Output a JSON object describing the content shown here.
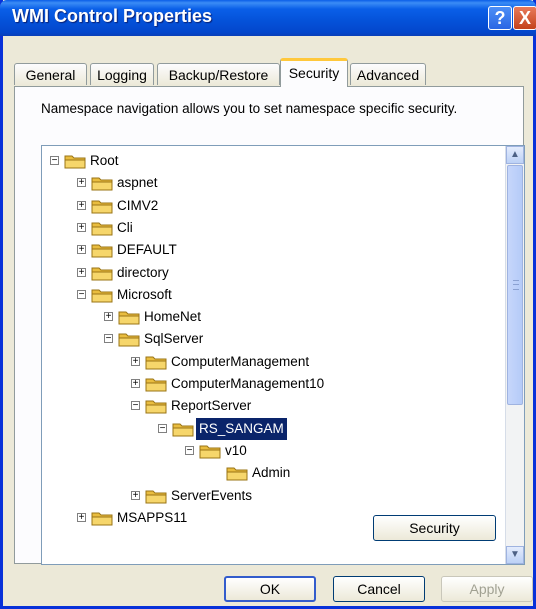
{
  "window": {
    "title": "WMI Control Properties",
    "help_glyph": "?",
    "close_glyph": "X"
  },
  "tabs": [
    "General",
    "Logging",
    "Backup/Restore",
    "Security",
    "Advanced"
  ],
  "active_tab": "Security",
  "description": "Namespace navigation allows you to set namespace specific security.",
  "tree": [
    {
      "label": "Root",
      "level": 0,
      "expander": "minus"
    },
    {
      "label": "aspnet",
      "level": 1,
      "expander": "plus"
    },
    {
      "label": "CIMV2",
      "level": 1,
      "expander": "plus"
    },
    {
      "label": "Cli",
      "level": 1,
      "expander": "plus"
    },
    {
      "label": "DEFAULT",
      "level": 1,
      "expander": "plus"
    },
    {
      "label": "directory",
      "level": 1,
      "expander": "plus"
    },
    {
      "label": "Microsoft",
      "level": 1,
      "expander": "minus"
    },
    {
      "label": "HomeNet",
      "level": 2,
      "expander": "plus"
    },
    {
      "label": "SqlServer",
      "level": 2,
      "expander": "minus"
    },
    {
      "label": "ComputerManagement",
      "level": 3,
      "expander": "plus"
    },
    {
      "label": "ComputerManagement10",
      "level": 3,
      "expander": "plus"
    },
    {
      "label": "ReportServer",
      "level": 3,
      "expander": "minus"
    },
    {
      "label": "RS_SANGAM",
      "level": 4,
      "expander": "minus",
      "selected": true
    },
    {
      "label": "v10",
      "level": 5,
      "expander": "minus"
    },
    {
      "label": "Admin",
      "level": 6,
      "expander": "none"
    },
    {
      "label": "ServerEvents",
      "level": 3,
      "expander": "plus"
    },
    {
      "label": "MSAPPS11",
      "level": 1,
      "expander": "plus"
    }
  ],
  "buttons": {
    "security": "Security",
    "ok": "OK",
    "cancel": "Cancel",
    "apply": "Apply"
  },
  "scrollbar": {
    "up_glyph": "▲",
    "down_glyph": "▼"
  },
  "colors": {
    "title_bar": "#0451d8",
    "selection": "#0a246a",
    "folder": "#f2cf63",
    "dialog_bg": "#ece9d8"
  },
  "icons": {
    "folder": "folder-icon",
    "expand": "plus-box-icon",
    "collapse": "minus-box-icon"
  }
}
